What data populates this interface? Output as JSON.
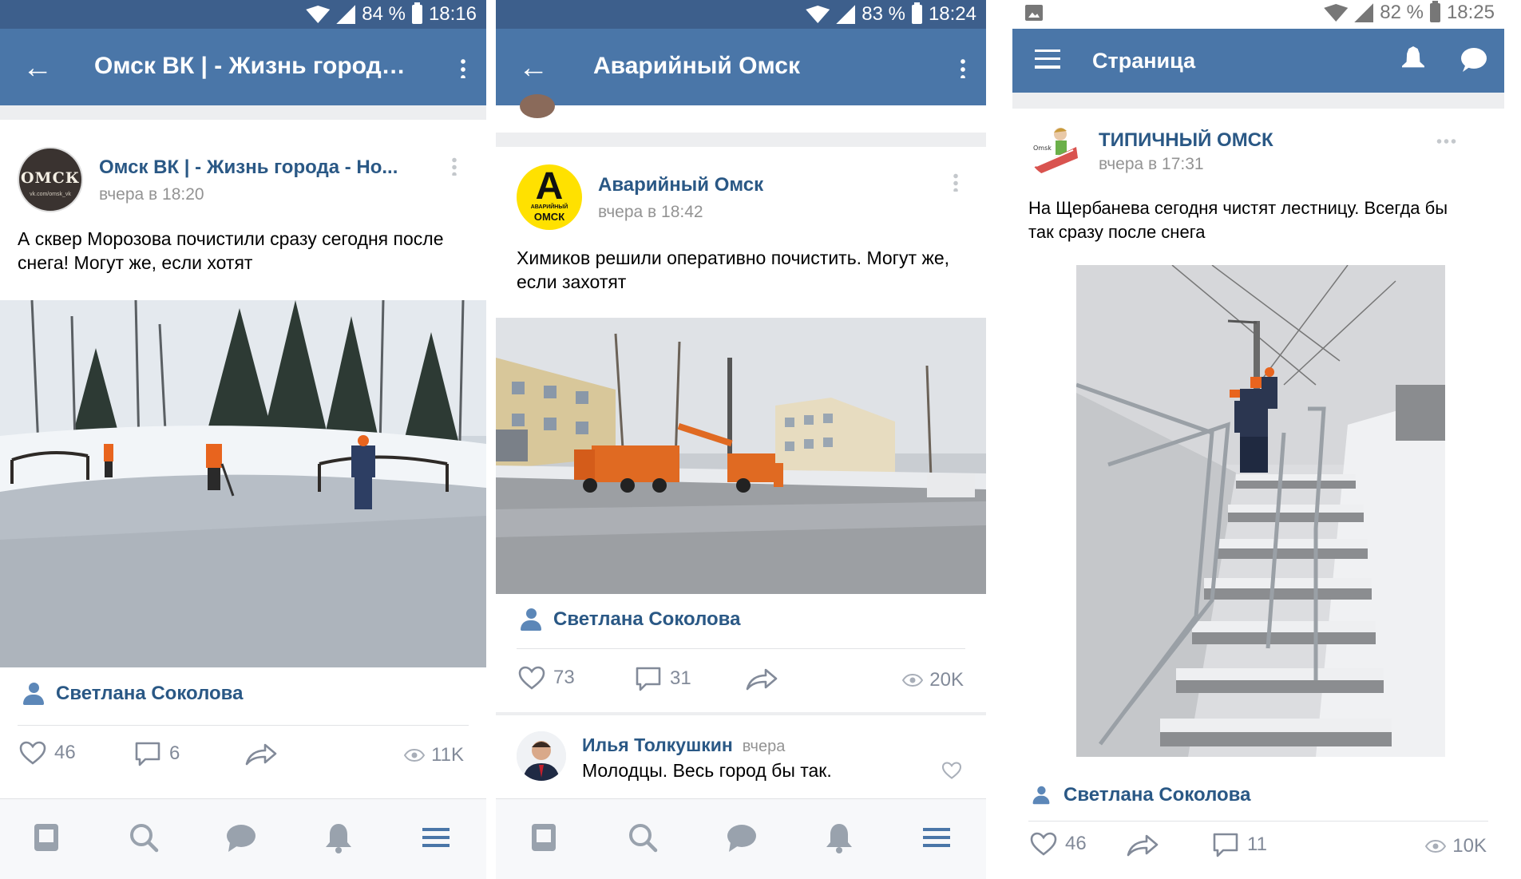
{
  "screens": [
    {
      "status": {
        "battery": "84 %",
        "time": "18:16"
      },
      "appbar": {
        "title": "Омск ВК | - Жизнь города -..."
      },
      "post": {
        "name": "Омск ВК | - Жизнь города - Но...",
        "time": "вчера в 18:20",
        "text": "А сквер Морозова почистили сразу сегодня после снега! Могут же, если хотят",
        "avatar_text": "ОМСК",
        "avatar_sub": "vk.com/omsk_vk",
        "author": "Светлана Соколова",
        "likes": "46",
        "comments": "6",
        "views": "11K"
      }
    },
    {
      "status": {
        "battery": "83 %",
        "time": "18:24"
      },
      "appbar": {
        "title": "Аварийный Омск"
      },
      "post": {
        "name": "Аварийный Омск",
        "time": "вчера в 18:42",
        "text": "Химиков решили оперативно почистить. Могут же, если захотят",
        "avatar_letter": "A",
        "avatar_sub1": "АВАРИЙНЫЙ",
        "avatar_sub2": "ОМСК",
        "author": "Светлана Соколова",
        "likes": "73",
        "comments": "31",
        "views": "20K"
      },
      "comment": {
        "name": "Илья Толкушкин",
        "time": "вчера",
        "text": "Молодцы. Весь город бы так."
      }
    },
    {
      "status": {
        "battery": "82 %",
        "time": "18:25"
      },
      "appbar": {
        "title": "Страница"
      },
      "post": {
        "name": "ТИПИЧНЫЙ ОМСК",
        "time": "вчера в 17:31",
        "text": "На Щербанева сегодня чистят лестницу. Всегда бы так сразу после снега",
        "author": "Светлана Соколова",
        "likes": "46",
        "comments": "11",
        "views": "10K"
      }
    }
  ],
  "icons": {
    "status": [
      "wifi-icon",
      "signal-icon",
      "battery-icon"
    ],
    "nav": [
      "news-icon",
      "search-icon",
      "messages-icon",
      "notifications-icon",
      "menu-icon"
    ],
    "actions": [
      "heart-icon",
      "comment-icon",
      "share-icon",
      "eye-icon"
    ]
  },
  "colors": {
    "vk_blue": "#4a76a8",
    "status_dark": "#3d5f8c",
    "link": "#2a5885",
    "muted": "#828a99",
    "background": "#edeef0"
  }
}
